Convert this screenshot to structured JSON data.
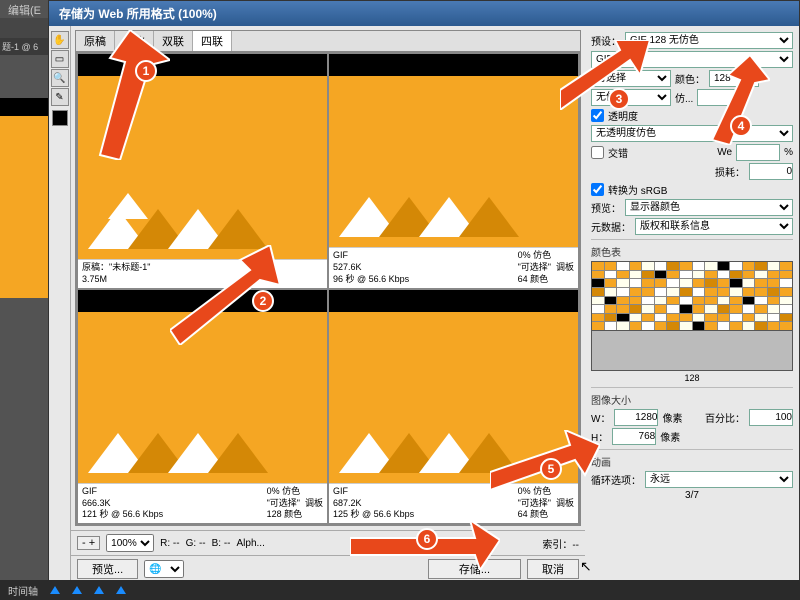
{
  "menubar": "编辑(E",
  "dialog_title": "存储为 Web 所用格式 (100%)",
  "tabs": [
    "原稿",
    "优化",
    "双联",
    "四联"
  ],
  "active_tab": 3,
  "panes": [
    {
      "name": "原稿：\"未标题-1\"",
      "size": "3.75M",
      "r1": "",
      "r2": "",
      "r3": ""
    },
    {
      "name": "GIF",
      "size": "527.6K",
      "time": "96 秒 @ 56.6 Kbps",
      "r1": "0% 仿色",
      "r2": "\"可选择\"  调板",
      "r3": "64 颜色"
    },
    {
      "name": "GIF",
      "size": "666.3K",
      "time": "121 秒 @ 56.6 Kbps",
      "r1": "0% 仿色",
      "r2": "\"可选择\"  调板",
      "r3": "128 颜色"
    },
    {
      "name": "GIF",
      "size": "687.2K",
      "time": "125 秒 @ 56.6 Kbps",
      "r1": "0% 仿色",
      "r2": "\"可选择\"  调板",
      "r3": "64 颜色"
    }
  ],
  "bottom": {
    "zoom": "100%",
    "r": "R: --",
    "g": "G: --",
    "b": "B: --",
    "alpha": "Alph...",
    "index": "索引：--",
    "preview": "预览..."
  },
  "right": {
    "preset_label": "预设：",
    "preset": "GIF 128 无仿色",
    "format": "GIF",
    "reduction": "可选择",
    "colors_label": "颜色：",
    "colors": "128",
    "dither": "无仿色",
    "dither_amt_label": "仿...",
    "transparency": "透明度",
    "matte": "无透明度仿色",
    "interlace": "交错",
    "web_label": "We",
    "web_val": "%",
    "lossy_label": "损耗：",
    "lossy": "0",
    "srgb": "转换为 sRGB",
    "preview_label": "预览：",
    "preview_val": "显示器颜色",
    "metadata_label": "元数据：",
    "metadata_val": "版权和联系信息",
    "colortable": "颜色表",
    "ct_count": "128",
    "imgsize": "图像大小",
    "w_label": "W：",
    "w": "1280",
    "h_label": "H：",
    "h": "768",
    "unit": "像素",
    "percent_label": "百分比：",
    "percent": "100",
    "anim": "动画",
    "loop_label": "循环选项：",
    "loop": "永远",
    "frames": "3/7"
  },
  "buttons": {
    "save": "存储...",
    "cancel": "取消"
  },
  "badges": [
    "1",
    "2",
    "3",
    "4",
    "5",
    "6"
  ],
  "ps_tab": "题-1 @ 6",
  "timeline": "时间轴"
}
